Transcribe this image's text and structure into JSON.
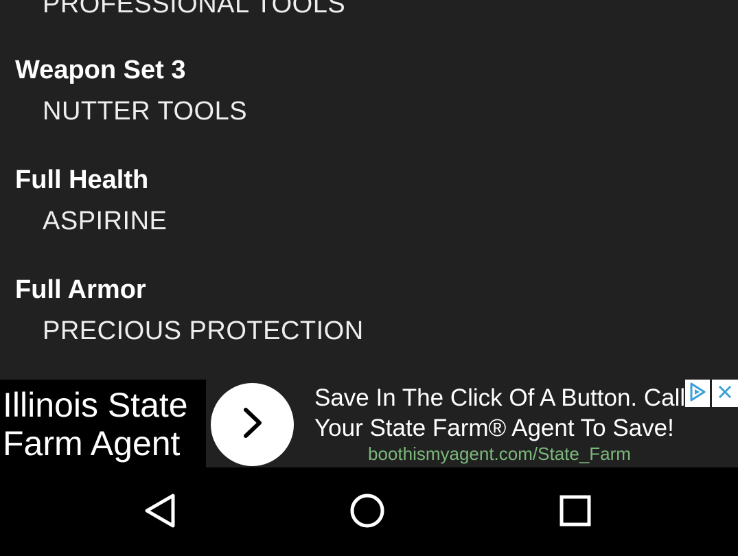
{
  "cheats": [
    {
      "title": "",
      "code": "PROFESSIONAL TOOLS"
    },
    {
      "title": "Weapon Set 3",
      "code": "NUTTER TOOLS"
    },
    {
      "title": "Full Health",
      "code": "ASPIRINE"
    },
    {
      "title": "Full Armor",
      "code": "PRECIOUS PROTECTION"
    }
  ],
  "ad": {
    "headline_line1": "Illinois State",
    "headline_line2": "Farm Agent",
    "body_line1": "Save In The Click Of A Button. Call",
    "body_line2": "Your State Farm® Agent To Save!",
    "url": "boothismyagent.com/State_Farm",
    "go_icon": "chevron-right-icon",
    "adchoices_icon": "adchoices-icon",
    "close_icon": "close-icon",
    "accent_color": "#3aa0d8",
    "url_color": "#7cb87c"
  },
  "navbar": {
    "back_icon": "back-triangle-icon",
    "home_icon": "home-circle-icon",
    "recents_icon": "recents-square-icon"
  }
}
